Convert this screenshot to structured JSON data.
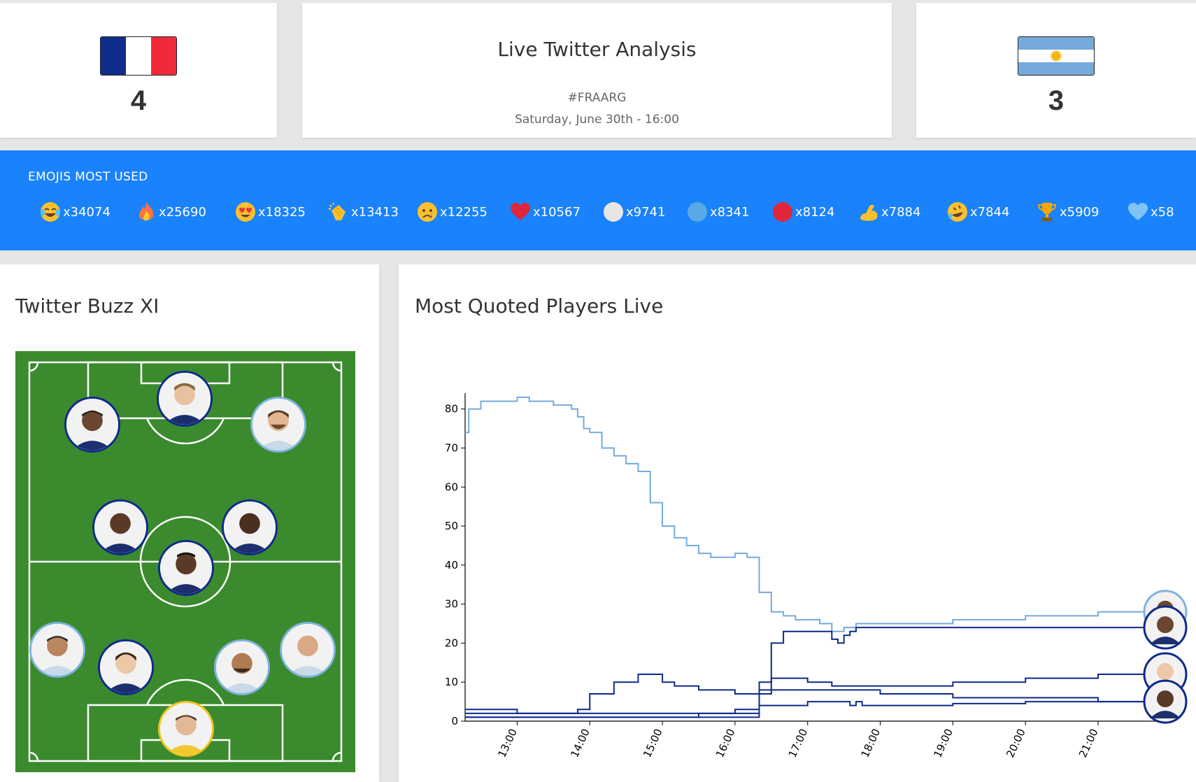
{
  "match": {
    "home": {
      "country": "France",
      "score": "4",
      "colors": [
        "#0f2d8c",
        "#ffffff",
        "#ef2b3b"
      ]
    },
    "away": {
      "country": "Argentina",
      "score": "3",
      "colors": [
        "#75aadb",
        "#ffffff",
        "#75aadb"
      ]
    },
    "title": "Live Twitter Analysis",
    "hashtag": "#FRAARG",
    "datetime": "Saturday, June 30th - 16:00"
  },
  "emojis": {
    "title": "EMOJIS MOST USED",
    "accent": "#1a82fb",
    "items": [
      {
        "icon": "face-with-tears-of-joy-icon",
        "count": "x34074"
      },
      {
        "icon": "fire-icon",
        "count": "x25690"
      },
      {
        "icon": "heart-eyes-icon",
        "count": "x18325"
      },
      {
        "icon": "clapping-hands-icon",
        "count": "x13413"
      },
      {
        "icon": "crying-face-icon",
        "count": "x12255"
      },
      {
        "icon": "red-heart-icon",
        "count": "x10567"
      },
      {
        "icon": "white-circle-icon",
        "count": "x9741"
      },
      {
        "icon": "blue-circle-icon",
        "count": "x8341"
      },
      {
        "icon": "red-circle-icon",
        "count": "x8124"
      },
      {
        "icon": "flexed-biceps-icon",
        "count": "x7884"
      },
      {
        "icon": "rolling-laughing-icon",
        "count": "x7844"
      },
      {
        "icon": "trophy-icon",
        "count": "x5909"
      },
      {
        "icon": "blue-heart-icon",
        "count": "x58"
      }
    ]
  },
  "buzz": {
    "title": "Twitter Buzz XI",
    "pitch_color": "#3b8a2e"
  },
  "chart_title": "Most Quoted Players Live",
  "chart_data": {
    "type": "line",
    "title": "Most Quoted Players Live",
    "xlabel": "",
    "ylabel": "",
    "ylim": [
      0,
      83
    ],
    "y_ticks": [
      0,
      10,
      20,
      30,
      40,
      50,
      60,
      70,
      80
    ],
    "x_ticks": [
      "13:00",
      "14:00",
      "15:00",
      "16:00",
      "17:00",
      "18:00",
      "19:00",
      "20:00",
      "21:00"
    ],
    "xlim": [
      "12:17",
      "21:52"
    ],
    "grid": false,
    "series": [
      {
        "color": "#75aadb",
        "x": [
          "12:17",
          "12:20",
          "12:30",
          "12:40",
          "13:00",
          "13:10",
          "13:30",
          "13:40",
          "13:45",
          "13:50",
          "13:55",
          "14:00",
          "14:10",
          "14:20",
          "14:30",
          "14:40",
          "14:50",
          "15:00",
          "15:10",
          "15:20",
          "15:30",
          "15:40",
          "15:50",
          "16:00",
          "16:10",
          "16:20",
          "16:30",
          "16:40",
          "16:50",
          "17:00",
          "17:10",
          "17:20",
          "17:30",
          "17:40",
          "17:50",
          "18:00",
          "19:00",
          "20:00",
          "21:00",
          "21:40"
        ],
        "y": [
          74,
          80,
          82,
          82,
          83,
          82,
          81,
          81,
          80,
          78,
          75,
          74,
          70,
          68,
          66,
          64,
          56,
          50,
          47,
          45,
          43,
          42,
          42,
          43,
          42,
          33,
          28,
          27,
          26,
          26,
          25,
          23,
          24,
          25,
          25,
          25,
          26,
          27,
          28,
          28.5
        ]
      },
      {
        "color": "#0d2a8a",
        "x": [
          "12:17",
          "16:10",
          "16:20",
          "16:30",
          "16:40",
          "17:00",
          "17:20",
          "17:25",
          "17:30",
          "17:35",
          "17:40",
          "18:00",
          "19:00",
          "20:00",
          "21:00",
          "21:40"
        ],
        "y": [
          1,
          1,
          10,
          20,
          23,
          23,
          21,
          20,
          22,
          23,
          24,
          24,
          24,
          24,
          24,
          24
        ]
      },
      {
        "color": "#0d2a8a",
        "x": [
          "12:17",
          "16:10",
          "16:20",
          "16:30",
          "17:00",
          "17:10",
          "17:20",
          "17:30",
          "17:40",
          "18:00",
          "19:00",
          "20:00",
          "21:00",
          "21:40"
        ],
        "y": [
          2,
          2,
          7,
          11,
          10,
          10,
          9,
          9,
          9,
          9,
          10,
          11,
          12,
          12
        ]
      },
      {
        "color": "#0d2a8a",
        "x": [
          "12:17",
          "13:00",
          "13:50",
          "14:00",
          "14:20",
          "14:40",
          "14:50",
          "15:00",
          "15:10",
          "15:30",
          "16:00",
          "16:15",
          "16:20",
          "17:00",
          "17:20",
          "17:40",
          "18:00",
          "19:00",
          "20:00",
          "21:00",
          "21:40"
        ],
        "y": [
          3,
          2,
          3,
          7,
          10,
          12,
          12,
          10,
          9,
          8,
          7,
          7,
          8,
          8,
          8,
          8,
          7,
          6,
          6,
          5,
          5
        ]
      },
      {
        "color": "#0d2a8a",
        "x": [
          "12:17",
          "14:30",
          "15:00",
          "15:30",
          "15:50",
          "16:00",
          "16:20",
          "17:00",
          "17:20",
          "17:35",
          "17:40",
          "17:45",
          "17:50",
          "18:00",
          "19:00",
          "20:00",
          "21:00",
          "21:40"
        ],
        "y": [
          1,
          1,
          1,
          2,
          2,
          3,
          4,
          5,
          5,
          4,
          5,
          4,
          4,
          4,
          4.5,
          5,
          5,
          5
        ]
      }
    ]
  }
}
